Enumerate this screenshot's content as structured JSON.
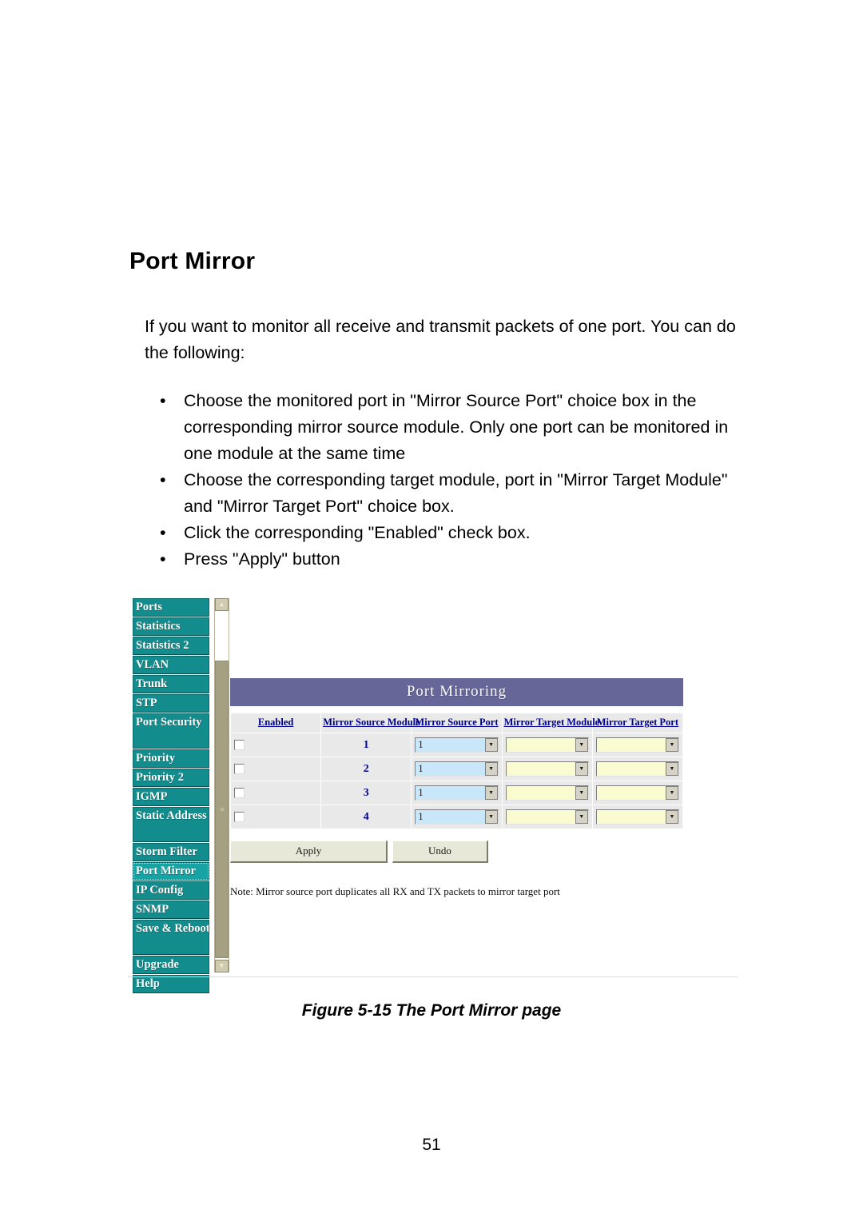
{
  "document": {
    "heading": "Port Mirror",
    "intro": "If you want to monitor all receive and transmit packets of one port. You can do the following:",
    "bullet_glyph": "•",
    "bullets": [
      "Choose the monitored port in \"Mirror Source Port\" choice box in the corresponding mirror source module. Only one port can be monitored in one module at the same time",
      "Choose the corresponding target module, port in \"Mirror Target Module\" and \"Mirror Target Port\" choice box.",
      "Click the corresponding \"Enabled\" check box.",
      "Press \"Apply\" button"
    ],
    "caption_number": "Figure 5-15",
    "caption_text": " The Port Mirror page",
    "page_number": "51"
  },
  "figure": {
    "sidebar": {
      "items": [
        {
          "label": "Ports",
          "selected": false,
          "lines": 1
        },
        {
          "label": "Statistics",
          "selected": false,
          "lines": 1
        },
        {
          "label": "Statistics 2",
          "selected": false,
          "lines": 1
        },
        {
          "label": "VLAN",
          "selected": false,
          "lines": 1
        },
        {
          "label": "Trunk",
          "selected": false,
          "lines": 1
        },
        {
          "label": "STP",
          "selected": false,
          "lines": 1
        },
        {
          "label": "Port Security",
          "selected": false,
          "lines": 2
        },
        {
          "label": "Priority",
          "selected": false,
          "lines": 1
        },
        {
          "label": "Priority 2",
          "selected": false,
          "lines": 1
        },
        {
          "label": "IGMP",
          "selected": false,
          "lines": 1
        },
        {
          "label": "Static Address",
          "selected": false,
          "lines": 2
        },
        {
          "label": "Storm Filter",
          "selected": false,
          "lines": 1
        },
        {
          "label": "Port Mirror",
          "selected": true,
          "lines": 1
        },
        {
          "label": "IP Config",
          "selected": false,
          "lines": 1
        },
        {
          "label": "SNMP",
          "selected": false,
          "lines": 1
        },
        {
          "label": "Save & Reboot",
          "selected": false,
          "lines": 2
        },
        {
          "label": "Upgrade",
          "selected": false,
          "lines": 1
        },
        {
          "label": "Help",
          "selected": false,
          "lines": 1
        }
      ]
    },
    "scrollbar": {
      "up_glyph": "▲",
      "down_glyph": "▼",
      "grip_glyph": "≡"
    },
    "panel": {
      "title": "Port Mirroring",
      "columns": [
        "Enabled",
        "Mirror Source Module",
        "Mirror Source Port",
        "Mirror Target Module",
        "Mirror Target Port"
      ],
      "rows": [
        {
          "enabled": false,
          "source_module": "1",
          "source_port": "1",
          "target_module": "",
          "target_port": ""
        },
        {
          "enabled": false,
          "source_module": "2",
          "source_port": "1",
          "target_module": "",
          "target_port": ""
        },
        {
          "enabled": false,
          "source_module": "3",
          "source_port": "1",
          "target_module": "",
          "target_port": ""
        },
        {
          "enabled": false,
          "source_module": "4",
          "source_port": "1",
          "target_module": "",
          "target_port": ""
        }
      ],
      "dropdown_arrow": "▼",
      "apply_label": "Apply",
      "undo_label": "Undo",
      "note": "Note: Mirror source port duplicates all RX and TX packets to mirror target port"
    },
    "colors": {
      "nav_bg": "#128c8c",
      "nav_selected_bg": "#17a3a3",
      "panel_title_bg": "#666699",
      "header_text": "#00008f",
      "source_cell_bg": "#c9e7fb",
      "target_cell_bg": "#fbfbd2",
      "button_bg": "#e8e8d8",
      "scrollbar_thumb": "#a6a083"
    }
  }
}
